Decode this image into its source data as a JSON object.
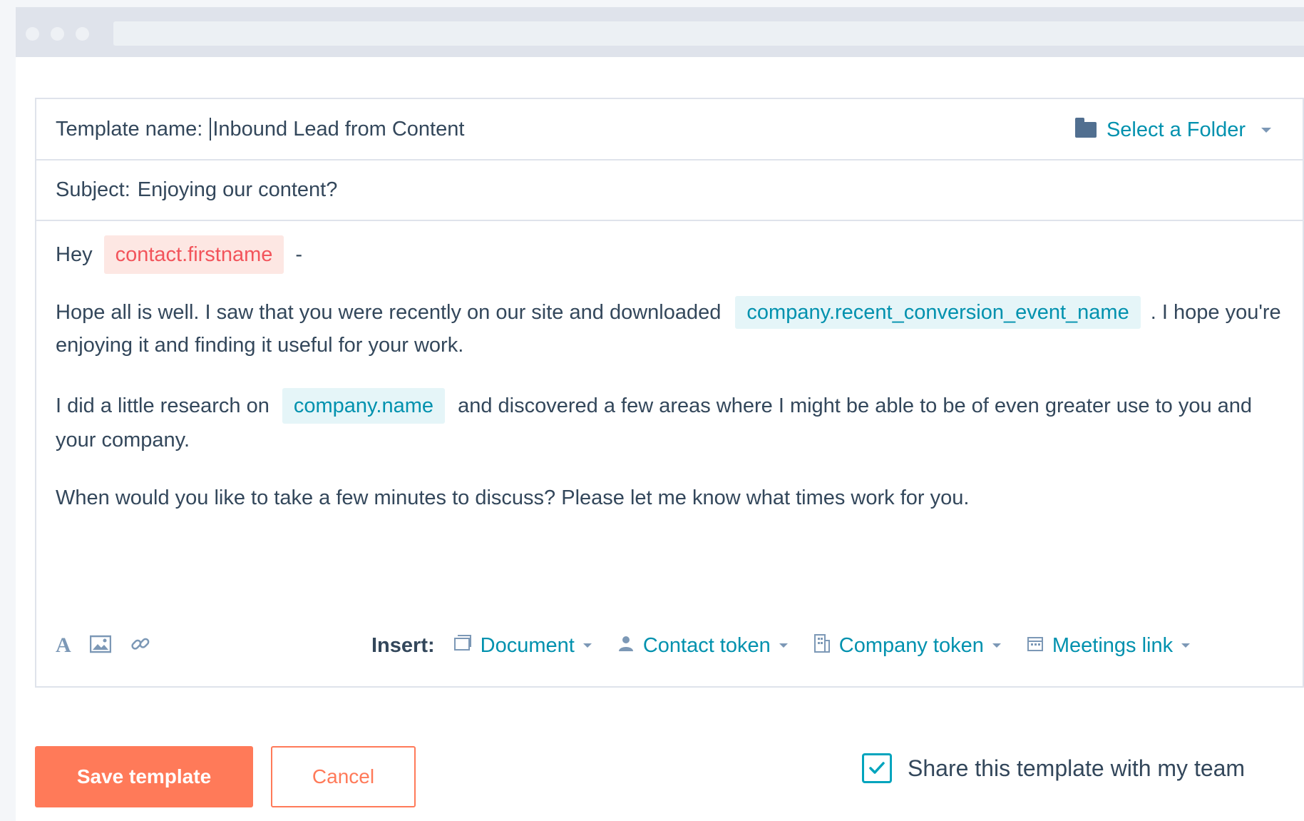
{
  "template": {
    "name_label": "Template name:",
    "name_value": "Inbound Lead from Content",
    "folder_label": "Select a Folder",
    "subject_label": "Subject:",
    "subject_value": "Enjoying our content?"
  },
  "body": {
    "greeting": "Hey",
    "greeting_token": "contact.firstname",
    "greeting_suffix": "-",
    "p1_start": "Hope all is well. I saw that you were recently on our site and downloaded",
    "p1_token": "company.recent_conversion_event_name",
    "p1_end": ". I hope you're enjoying it and finding it useful for your work.",
    "p2_start": "I did a little research on",
    "p2_token": "company.name",
    "p2_end": "and discovered a few areas where I might be able to be of even greater use to you and your company.",
    "p3": "When would you like to take a few minutes to discuss? Please let me know what times work for you."
  },
  "toolbar": {
    "insert_label": "Insert:",
    "document": "Document",
    "contact_token": "Contact token",
    "company_token": "Company token",
    "meetings_link": "Meetings link"
  },
  "footer": {
    "save_label": "Save template",
    "cancel_label": "Cancel",
    "share_label": "Share this template with my team",
    "share_checked": true
  },
  "colors": {
    "accent_orange": "#ff7a59",
    "link_teal": "#0091ae",
    "text": "#33475b"
  }
}
